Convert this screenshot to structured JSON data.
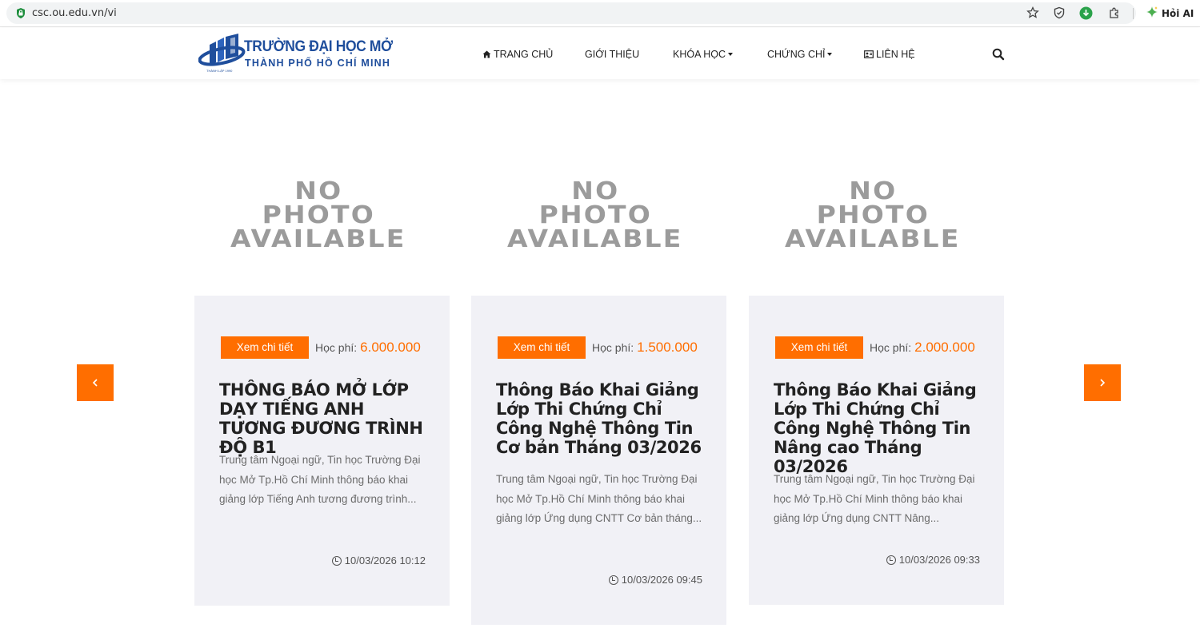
{
  "browser": {
    "url": "csc.ou.edu.vn/vi",
    "ask_ai_label": "Hỏi AI"
  },
  "site": {
    "logo": {
      "line1": "TRƯỜNG ĐẠI HỌC MỞ",
      "line2": "THÀNH PHỐ HỒ CHÍ MINH",
      "tiny": "THÀNH LẬP 1990"
    },
    "nav": {
      "home": "TRANG CHỦ",
      "about": "GIỚI THIỆU",
      "courses": "KHÓA HỌC",
      "certificates": "CHỨNG CHỈ",
      "contact": "LIÊN HỆ"
    }
  },
  "placeholder_image": {
    "line1": "NO",
    "line2": "PHOTO",
    "line3": "AVAILABLE"
  },
  "cards": [
    {
      "button_label": "Xem chi tiết",
      "fee_label": "Học phí:",
      "fee_value": "6.000.000",
      "title": "THÔNG BÁO MỞ LỚP DẠY TIẾNG ANH TƯƠNG ĐƯƠNG TRÌNH ĐỘ B1",
      "excerpt": "Trung tâm Ngoại ngữ, Tin học Trường Đại học Mở Tp.Hồ Chí Minh thông báo khai giảng lớp Tiếng Anh tương đương trình...",
      "date": "10/03/2026 10:12"
    },
    {
      "button_label": "Xem chi tiết",
      "fee_label": "Học phí:",
      "fee_value": "1.500.000",
      "title": "Thông Báo Khai Giảng Lớp Thi Chứng Chỉ Công Nghệ Thông Tin Cơ bản Tháng 03/2026",
      "excerpt": "Trung tâm Ngoại ngữ, Tin học Trường Đại học Mở Tp.Hồ Chí Minh thông báo khai giảng lớp Ứng dụng CNTT Cơ bản tháng...",
      "date": "10/03/2026 09:45"
    },
    {
      "button_label": "Xem chi tiết",
      "fee_label": "Học phí:",
      "fee_value": "2.000.000",
      "title": "Thông Báo Khai Giảng Lớp Thi Chứng Chỉ Công Nghệ Thông Tin Nâng cao Tháng 03/2026",
      "excerpt": "Trung tâm Ngoại ngữ, Tin học Trường Đại học Mở Tp.Hồ Chí Minh thông báo khai giảng lớp Ứng dụng CNTT Nâng...",
      "date": "10/03/2026 09:33"
    }
  ],
  "colors": {
    "accent": "#ff6e00",
    "brand_blue": "#1f4e9c",
    "card_bg": "#f1f1f6"
  },
  "icons": {
    "lock": "lock-icon",
    "star": "star-icon",
    "shield": "shield-icon",
    "download": "download-icon",
    "extensions": "puzzle-icon",
    "ask_ai": "sparkle-icon",
    "home": "home-icon",
    "contact": "contact-card-icon",
    "search": "search-icon",
    "clock": "clock-icon",
    "prev": "chevron-left-icon",
    "next": "chevron-right-icon"
  }
}
